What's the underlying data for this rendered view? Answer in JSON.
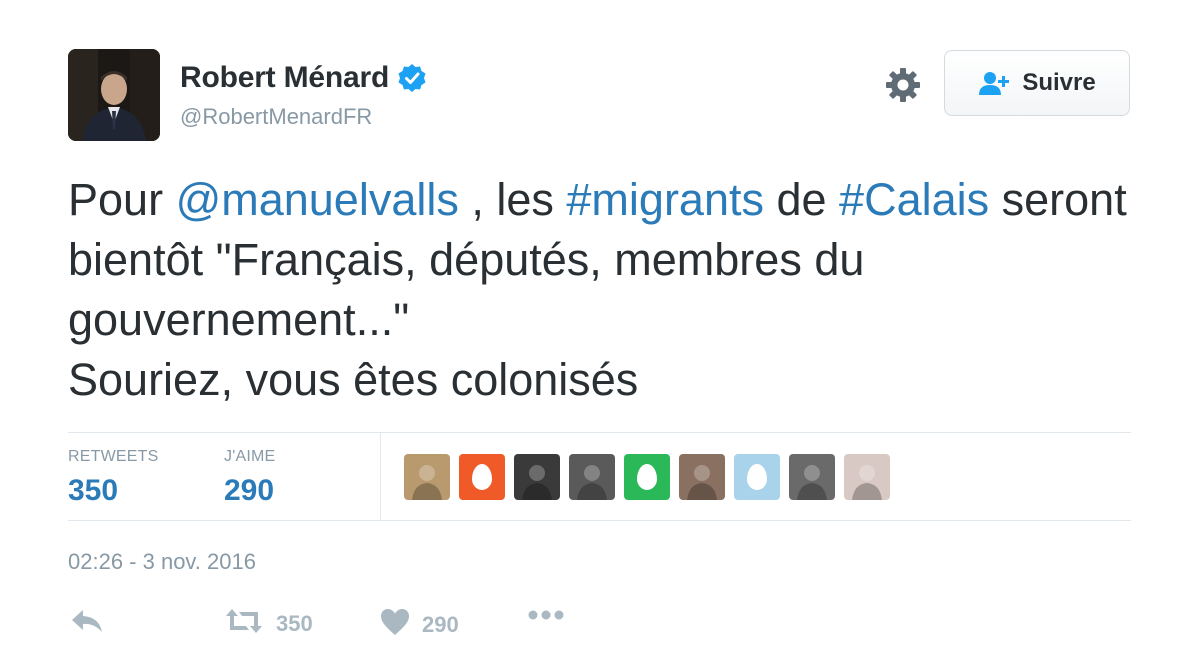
{
  "user": {
    "display_name": "Robert Ménard",
    "handle": "@RobertMenardFR",
    "avatar_icon": "profile-photo",
    "verified_icon": "verified-badge-icon"
  },
  "follow_button": {
    "label": "Suivre",
    "icon": "add-user-icon"
  },
  "settings_icon": "gear-icon",
  "tweet": {
    "segments": [
      {
        "text": "Pour ",
        "link": false
      },
      {
        "text": "@manuelvalls",
        "link": true
      },
      {
        "text": " , les ",
        "link": false
      },
      {
        "text": "#migrants",
        "link": true
      },
      {
        "text": " de ",
        "link": false
      },
      {
        "text": "#Calais",
        "link": true
      },
      {
        "text": " seront bientôt \"Français, députés, membres du gouvernement...\"",
        "link": false
      },
      {
        "text": "Souriez, vous êtes colonisés",
        "link": false
      }
    ]
  },
  "stats": {
    "retweets_label": "RETWEETS",
    "retweets_value": "350",
    "likes_label": "J'AIME",
    "likes_value": "290"
  },
  "likers": [
    {
      "icon": "avatar-photo",
      "color": "#b89a6e"
    },
    {
      "icon": "default-egg-avatar",
      "color": "#f05a28"
    },
    {
      "icon": "avatar-photo",
      "color": "#3a3a3a"
    },
    {
      "icon": "avatar-photo",
      "color": "#5a5a5a"
    },
    {
      "icon": "default-egg-avatar",
      "color": "#2ab859"
    },
    {
      "icon": "avatar-photo",
      "color": "#8a7060"
    },
    {
      "icon": "default-egg-avatar",
      "color": "#a9d3ea"
    },
    {
      "icon": "avatar-photo",
      "color": "#6a6a6a"
    },
    {
      "icon": "avatar-photo",
      "color": "#d9c9c4"
    }
  ],
  "timestamp": "02:26 - 3 nov. 2016",
  "actions": {
    "reply_icon": "reply-icon",
    "retweet_icon": "retweet-icon",
    "retweet_count": "350",
    "like_icon": "heart-icon",
    "like_count": "290",
    "more_icon": "more-icon"
  },
  "colors": {
    "link": "#2b7bb9",
    "text": "#292f33",
    "muted": "#8899a6",
    "action_gray": "#aab8c2",
    "verified": "#1da1f2"
  }
}
